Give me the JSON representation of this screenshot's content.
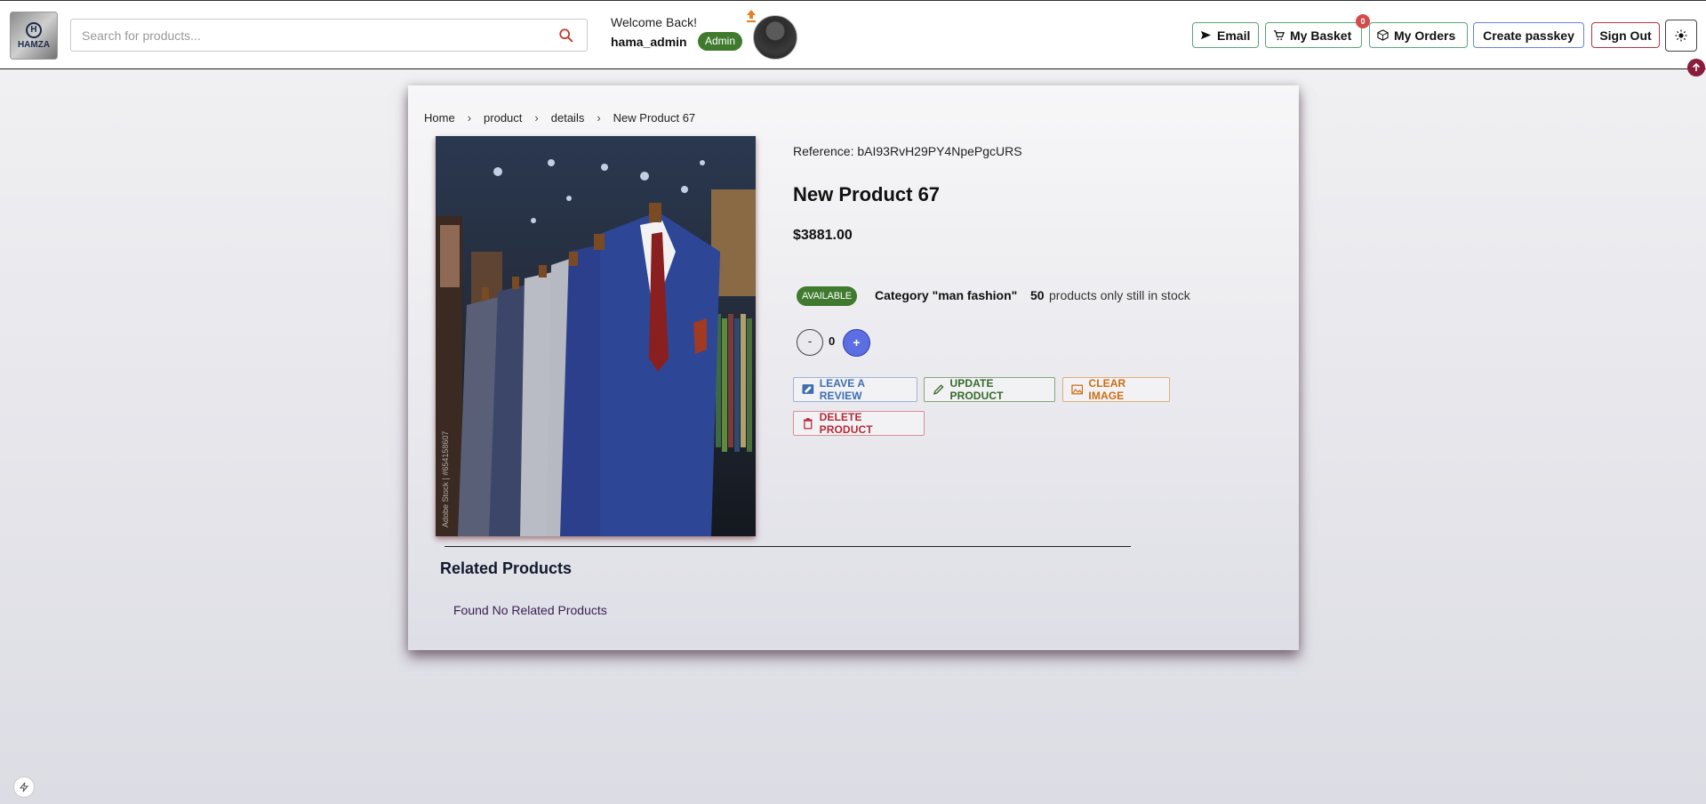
{
  "header": {
    "logo_text": "HAMZA",
    "search": {
      "placeholder": "Search for products..."
    },
    "welcome": "Welcome Back!",
    "username": "hama_admin",
    "role_badge": "Admin",
    "nav": {
      "email": "Email",
      "basket": "My Basket",
      "basket_count": "0",
      "orders": "My Orders",
      "passkey": "Create passkey",
      "signout": "Sign Out"
    }
  },
  "breadcrumb": [
    "Home",
    "product",
    "details",
    "New Product 67"
  ],
  "product": {
    "reference": "Reference: bAI93RvH29PY4NpePgcURS",
    "title": "New Product 67",
    "price": "$3881.00",
    "availability": "AVAILABLE",
    "category": "Category \"man fashion\"",
    "stock_count": "50",
    "stock_text": "products only still in stock",
    "quantity": "0",
    "qty_minus": "-",
    "qty_plus": "+"
  },
  "actions": {
    "review": "LEAVE A REVIEW",
    "update": "UPDATE PRODUCT",
    "clear_image": "CLEAR IMAGE",
    "delete": "DELETE PRODUCT"
  },
  "related": {
    "title": "Related Products",
    "empty_message": "Found No Related Products"
  },
  "colors": {
    "admin_badge": "#3f7a2e",
    "accent_blue": "#5b6fe3",
    "danger": "#b32b38",
    "warning": "#cc6d12"
  },
  "icons": [
    "search-icon",
    "send-icon",
    "cart-icon",
    "box-icon",
    "sun-icon",
    "upload-icon",
    "arrow-up-icon",
    "review-icon",
    "pencil-icon",
    "image-icon",
    "trash-icon",
    "bolt-icon"
  ]
}
